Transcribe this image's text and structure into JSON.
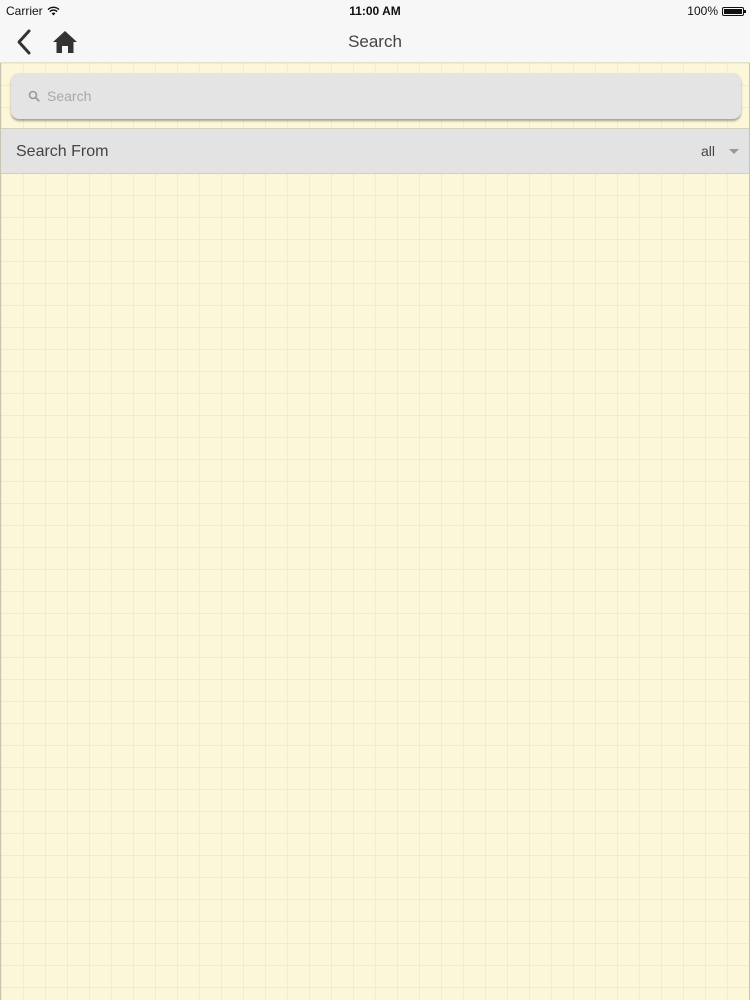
{
  "status_bar": {
    "carrier": "Carrier",
    "time": "11:00 AM",
    "battery": "100%"
  },
  "nav_bar": {
    "title": "Search",
    "back_icon": "chevron-left-icon",
    "home_icon": "home-icon"
  },
  "search": {
    "placeholder": "Search",
    "value": ""
  },
  "search_from": {
    "label": "Search From",
    "selected": "all"
  },
  "colors": {
    "background": "#fdf7d9",
    "bar": "#f7f7f7",
    "search_field": "#e4e4e4",
    "row": "#e3e3e3"
  }
}
